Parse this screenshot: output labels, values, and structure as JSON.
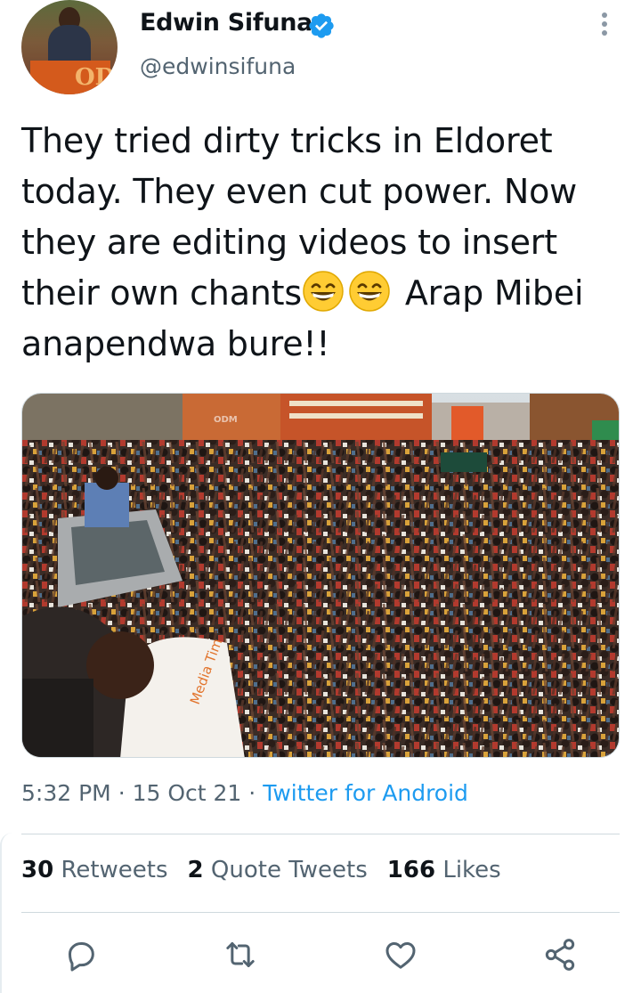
{
  "author": {
    "name": "Edwin Sifuna",
    "handle": "@edwinsifuna",
    "verified": true,
    "avatar_icon": "profile-photo-podium",
    "avatar_podium_text": "OD"
  },
  "tweet": {
    "text_parts": [
      "They tried dirty tricks in Eldoret today. They even cut power. Now they are editing videos to insert their own chants",
      " Arap Mibei anapendwa bure!!"
    ],
    "emoji": "grinning-face-with-smiling-eyes"
  },
  "media": {
    "description_icon": "crowd-photo",
    "overlay_texts": [
      "ODM",
      "Media Tim"
    ]
  },
  "meta": {
    "time": "5:32 PM",
    "separator": "·",
    "date": "15 Oct 21",
    "source": "Twitter for Android"
  },
  "stats": {
    "retweets_count": "30",
    "retweets_label": "Retweets",
    "quotes_count": "2",
    "quotes_label": "Quote Tweets",
    "likes_count": "166",
    "likes_label": "Likes"
  },
  "actions": [
    "reply-icon",
    "retweet-icon",
    "like-icon",
    "share-icon"
  ],
  "colors": {
    "accent": "#1d9bf0",
    "text": "#0f1419",
    "secondary": "#536471",
    "divider": "#cfd9de"
  }
}
